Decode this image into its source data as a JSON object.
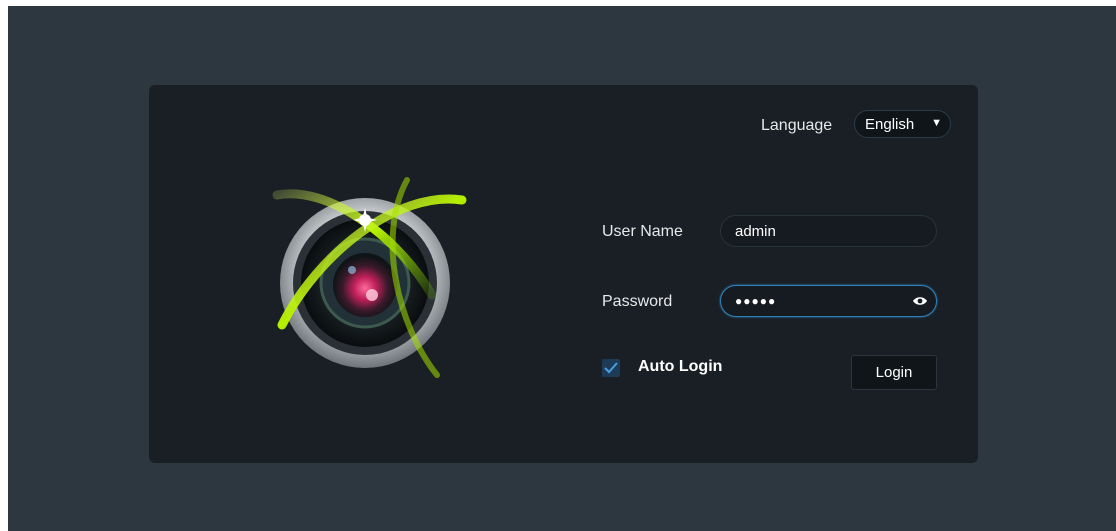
{
  "header": {
    "language_label": "Language",
    "language_selected": "English"
  },
  "form": {
    "username_label": "User Name",
    "username_value": "admin",
    "password_label": "Password",
    "password_masked": "●●●●●",
    "auto_login_label": "Auto Login",
    "auto_login_checked": true,
    "login_label": "Login"
  },
  "icons": {
    "logo": "camera-lens-logo-icon",
    "language_caret": "caret-down-icon",
    "show_password": "eye-icon",
    "checkbox": "checkmark-icon"
  },
  "colors": {
    "page_bg": "#2d3740",
    "panel_bg": "#1a1f25",
    "accent_green": "#b6f000",
    "focus_blue": "#2f7fb8"
  }
}
